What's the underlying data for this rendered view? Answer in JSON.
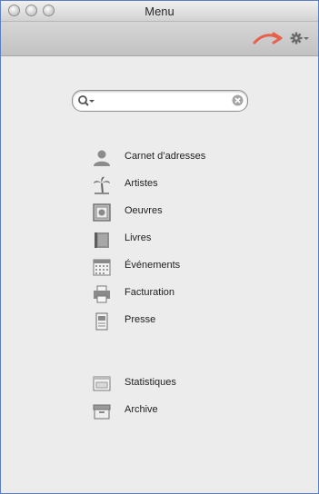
{
  "window": {
    "title": "Menu"
  },
  "search": {
    "placeholder": ""
  },
  "menu": [
    {
      "label": "Carnet d’adresses",
      "icon": "person-icon"
    },
    {
      "label": "Artistes",
      "icon": "palm-tree-icon"
    },
    {
      "label": "Oeuvres",
      "icon": "artwork-icon"
    },
    {
      "label": "Livres",
      "icon": "book-icon"
    },
    {
      "label": "Événements",
      "icon": "calendar-icon"
    },
    {
      "label": "Facturation",
      "icon": "printer-icon"
    },
    {
      "label": "Presse",
      "icon": "newspaper-icon"
    }
  ],
  "secondary_menu": [
    {
      "label": "Statistiques",
      "icon": "chart-window-icon"
    },
    {
      "label": "Archive",
      "icon": "archive-box-icon"
    }
  ],
  "colors": {
    "accent_arrow": "#e8604c",
    "window_border": "#5b7fc0"
  }
}
